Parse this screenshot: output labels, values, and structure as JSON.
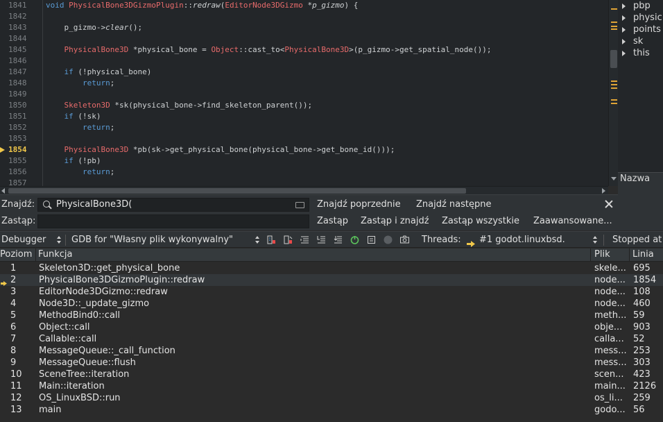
{
  "editor": {
    "lines": [
      {
        "num": "1841",
        "current": false,
        "tokens": [
          {
            "t": "void ",
            "c": "kw"
          },
          {
            "t": "PhysicalBone3DGizmoPlugin",
            "c": "type"
          },
          {
            "t": "::",
            "c": "norm"
          },
          {
            "t": "redraw",
            "c": "ital"
          },
          {
            "t": "(",
            "c": "norm"
          },
          {
            "t": "EditorNode3DGizmo",
            "c": "type"
          },
          {
            "t": " *",
            "c": "norm"
          },
          {
            "t": "p_gizmo",
            "c": "param"
          },
          {
            "t": ") {",
            "c": "norm"
          }
        ]
      },
      {
        "num": "1842",
        "current": false,
        "tokens": []
      },
      {
        "num": "1843",
        "current": false,
        "tokens": [
          {
            "t": "    p_gizmo->",
            "c": "norm"
          },
          {
            "t": "clear",
            "c": "ital"
          },
          {
            "t": "();",
            "c": "norm"
          }
        ]
      },
      {
        "num": "1844",
        "current": false,
        "tokens": []
      },
      {
        "num": "1845",
        "current": false,
        "tokens": [
          {
            "t": "    ",
            "c": "norm"
          },
          {
            "t": "PhysicalBone3D",
            "c": "type"
          },
          {
            "t": " *physical_bone = ",
            "c": "norm"
          },
          {
            "t": "Object",
            "c": "type"
          },
          {
            "t": "::cast_to<",
            "c": "norm"
          },
          {
            "t": "PhysicalBone3D",
            "c": "type"
          },
          {
            "t": ">(p_gizmo->get_spatial_node());",
            "c": "norm"
          }
        ]
      },
      {
        "num": "1846",
        "current": false,
        "tokens": []
      },
      {
        "num": "1847",
        "current": false,
        "tokens": [
          {
            "t": "    ",
            "c": "norm"
          },
          {
            "t": "if",
            "c": "kw"
          },
          {
            "t": " (!physical_bone)",
            "c": "norm"
          }
        ]
      },
      {
        "num": "1848",
        "current": false,
        "tokens": [
          {
            "t": "        ",
            "c": "norm"
          },
          {
            "t": "return",
            "c": "kw"
          },
          {
            "t": ";",
            "c": "norm"
          }
        ]
      },
      {
        "num": "1849",
        "current": false,
        "tokens": []
      },
      {
        "num": "1850",
        "current": false,
        "tokens": [
          {
            "t": "    ",
            "c": "norm"
          },
          {
            "t": "Skeleton3D",
            "c": "type"
          },
          {
            "t": " *sk(physical_bone->find_skeleton_parent());",
            "c": "norm"
          }
        ]
      },
      {
        "num": "1851",
        "current": false,
        "tokens": [
          {
            "t": "    ",
            "c": "norm"
          },
          {
            "t": "if",
            "c": "kw"
          },
          {
            "t": " (!sk)",
            "c": "norm"
          }
        ]
      },
      {
        "num": "1852",
        "current": false,
        "tokens": [
          {
            "t": "        ",
            "c": "norm"
          },
          {
            "t": "return",
            "c": "kw"
          },
          {
            "t": ";",
            "c": "norm"
          }
        ]
      },
      {
        "num": "1853",
        "current": false,
        "tokens": []
      },
      {
        "num": "1854",
        "current": true,
        "tokens": [
          {
            "t": "    ",
            "c": "norm"
          },
          {
            "t": "PhysicalBone3D",
            "c": "type"
          },
          {
            "t": " *pb(sk->get_physical_bone(physical_bone->get_bone_id()));",
            "c": "norm"
          }
        ]
      },
      {
        "num": "1855",
        "current": false,
        "tokens": [
          {
            "t": "    ",
            "c": "norm"
          },
          {
            "t": "if",
            "c": "kw"
          },
          {
            "t": " (!pb)",
            "c": "norm"
          }
        ]
      },
      {
        "num": "1856",
        "current": false,
        "tokens": [
          {
            "t": "        ",
            "c": "norm"
          },
          {
            "t": "return",
            "c": "kw"
          },
          {
            "t": ";",
            "c": "norm"
          }
        ]
      },
      {
        "num": "1857",
        "current": false,
        "tokens": []
      }
    ]
  },
  "outline": {
    "items": [
      {
        "label": "pbp",
        "expandable": true
      },
      {
        "label": "physic",
        "expandable": false
      },
      {
        "label": "points",
        "expandable": false
      },
      {
        "label": "sk",
        "expandable": false
      },
      {
        "label": "this",
        "expandable": false
      }
    ],
    "header": "Nazwa"
  },
  "find": {
    "find_label": "Znajdź:",
    "find_value": "PhysicalBone3D(",
    "replace_label": "Zastąp:",
    "replace_value": "",
    "find_prev": "Znajdź poprzednie",
    "find_next": "Znajdź następne",
    "replace": "Zastąp",
    "replace_find": "Zastąp i znajdź",
    "replace_all": "Zastąp wszystkie",
    "advanced": "Zaawansowane..."
  },
  "debugger": {
    "debugger_select": "Debugger",
    "target_select": "GDB for \"Własny plik wykonywalny\"",
    "threads_label": "Threads:",
    "thread_value": "#1 godot.linuxbsd.",
    "status": "Stopped at"
  },
  "stack": {
    "headers": {
      "level": "Poziom",
      "function": "Funkcja",
      "file": "Plik",
      "line": "Linia"
    },
    "rows": [
      {
        "level": "1",
        "function": "Skeleton3D::get_physical_bone",
        "file": "skele...",
        "line": "695",
        "current": false
      },
      {
        "level": "2",
        "function": "PhysicalBone3DGizmoPlugin::redraw",
        "file": "node...",
        "line": "1854",
        "current": true
      },
      {
        "level": "3",
        "function": "EditorNode3DGizmo::redraw",
        "file": "node...",
        "line": "108",
        "current": false
      },
      {
        "level": "4",
        "function": "Node3D::_update_gizmo",
        "file": "node...",
        "line": "460",
        "current": false
      },
      {
        "level": "5",
        "function": "MethodBind0::call",
        "file": "meth...",
        "line": "59",
        "current": false
      },
      {
        "level": "6",
        "function": "Object::call",
        "file": "obje...",
        "line": "903",
        "current": false
      },
      {
        "level": "7",
        "function": "Callable::call",
        "file": "calla...",
        "line": "52",
        "current": false
      },
      {
        "level": "8",
        "function": "MessageQueue::_call_function",
        "file": "mess...",
        "line": "253",
        "current": false
      },
      {
        "level": "9",
        "function": "MessageQueue::flush",
        "file": "mess...",
        "line": "303",
        "current": false
      },
      {
        "level": "10",
        "function": "SceneTree::iteration",
        "file": "scen...",
        "line": "423",
        "current": false
      },
      {
        "level": "11",
        "function": "Main::iteration",
        "file": "main...",
        "line": "2126",
        "current": false
      },
      {
        "level": "12",
        "function": "OS_LinuxBSD::run",
        "file": "os_li...",
        "line": "259",
        "current": false
      },
      {
        "level": "13",
        "function": "main",
        "file": "godo...",
        "line": "56",
        "current": false
      }
    ]
  },
  "colors": {
    "accent": "#f0c74a",
    "keyword": "#5a9bd5",
    "type": "#e86b6b",
    "background": "#232629"
  }
}
